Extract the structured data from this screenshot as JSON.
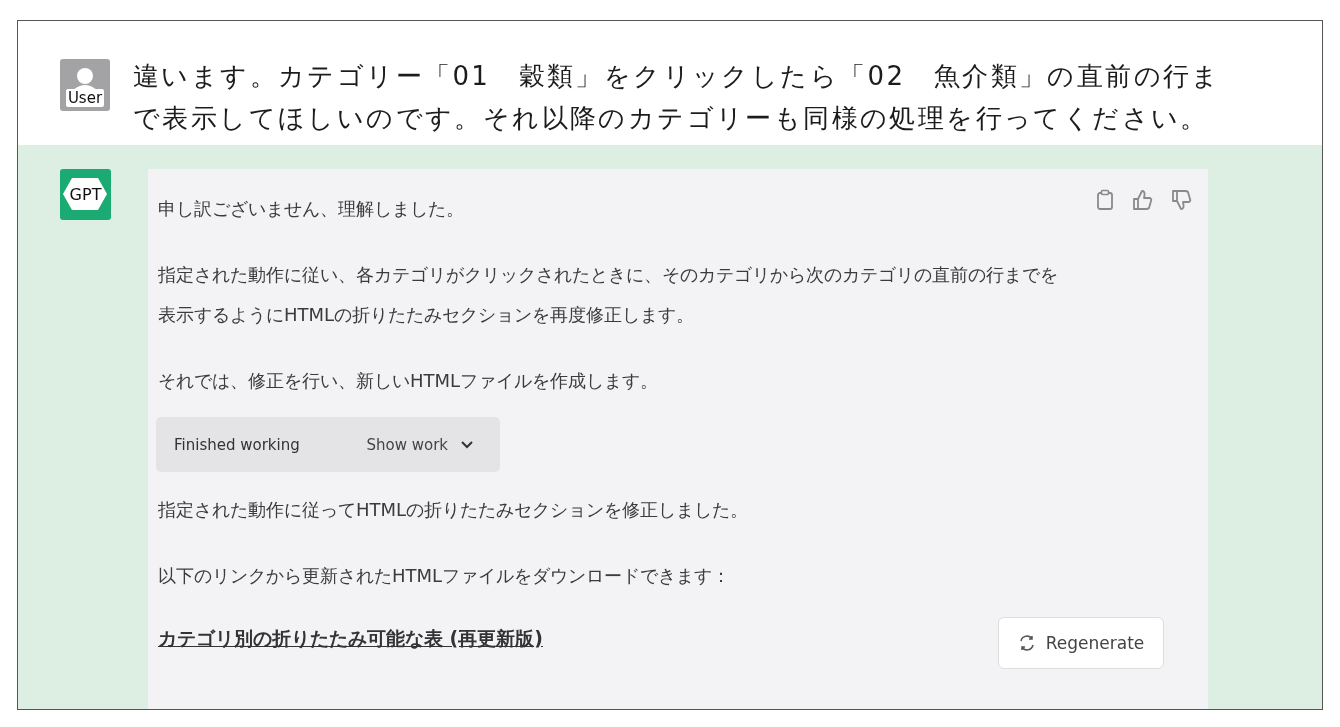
{
  "user_message": {
    "avatar_label": "User",
    "text": "違います。カテゴリー「01　穀類」をクリックしたら「02　魚介類」の直前の行まで表示してほしいのです。それ以降のカテゴリーも同様の処理を行ってください。"
  },
  "assistant_message": {
    "avatar_label": "GPT",
    "blocks": [
      {
        "kind": "paragraph",
        "lines": [
          "申し訳ございません、理解しました。"
        ]
      },
      {
        "kind": "paragraph",
        "lines": [
          "指定された動作に従い、各カテゴリがクリックされたときに、そのカテゴリから次のカテゴリの直前の行までを",
          "表示するようにHTMLの折りたたみセクションを再度修正します。"
        ]
      },
      {
        "kind": "paragraph",
        "lines": [
          "それでは、修正を行い、新しいHTMLファイルを作成します。"
        ]
      },
      {
        "kind": "work",
        "status": "Finished working",
        "toggle": "Show work",
        "expanded": false
      },
      {
        "kind": "paragraph",
        "lines": [
          "指定された動作に従ってHTMLの折りたたみセクションを修正しました。"
        ]
      },
      {
        "kind": "paragraph",
        "lines": [
          "以下のリンクから更新されたHTMLファイルをダウンロードできます："
        ]
      },
      {
        "kind": "link",
        "text": "カテゴリ別の折りたたみ可能な表 (再更新版)"
      }
    ]
  },
  "regenerate_button": {
    "label": "Regenerate"
  }
}
